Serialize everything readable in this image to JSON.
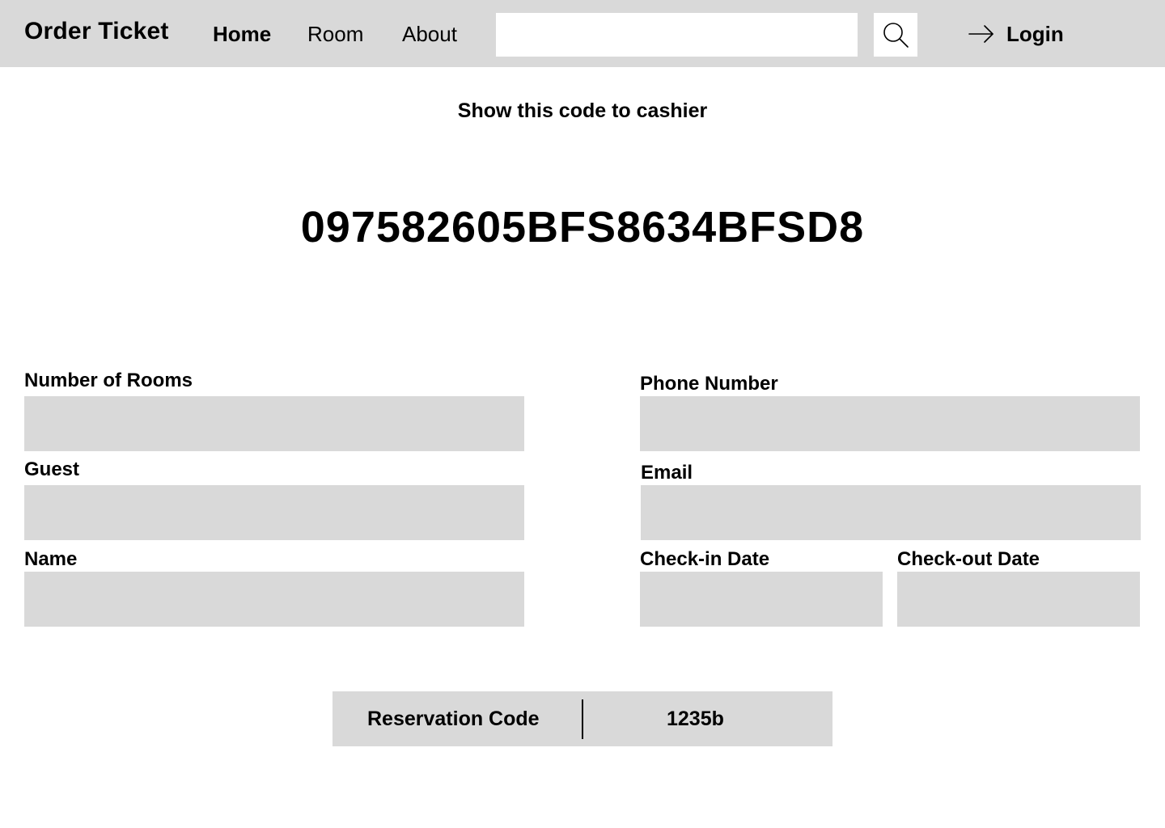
{
  "nav": {
    "brand": "Order Ticket",
    "links": [
      {
        "label": "Home",
        "active": true
      },
      {
        "label": "Room",
        "active": false
      },
      {
        "label": "About",
        "active": false
      }
    ],
    "search": {
      "value": "",
      "placeholder": ""
    },
    "search_icon": "search-icon",
    "login": {
      "label": "Login",
      "icon": "arrow-right-icon"
    }
  },
  "main": {
    "instruction": "Show this code to cashier",
    "ticket_code": "097582605BFS8634BFSD8"
  },
  "form": {
    "number_of_rooms": {
      "label": "Number of Rooms",
      "value": ""
    },
    "guest": {
      "label": "Guest",
      "value": ""
    },
    "name": {
      "label": "Name",
      "value": ""
    },
    "phone_number": {
      "label": "Phone Number",
      "value": ""
    },
    "email": {
      "label": "Email",
      "value": ""
    },
    "check_in_date": {
      "label": "Check-in Date",
      "value": ""
    },
    "check_out_date": {
      "label": "Check-out Date",
      "value": ""
    }
  },
  "reservation": {
    "label": "Reservation Code",
    "value": "1235b"
  },
  "colors": {
    "panel": "#d9d9d9",
    "background": "#ffffff",
    "text": "#000000"
  }
}
